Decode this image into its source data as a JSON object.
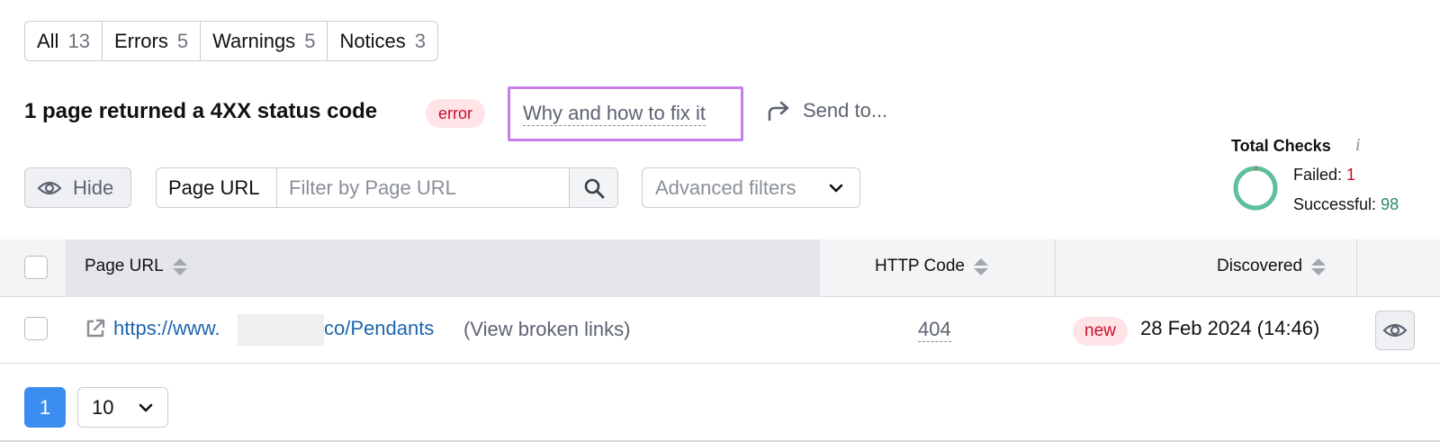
{
  "tabs": [
    {
      "label": "All",
      "count": "13"
    },
    {
      "label": "Errors",
      "count": "5"
    },
    {
      "label": "Warnings",
      "count": "5"
    },
    {
      "label": "Notices",
      "count": "3"
    }
  ],
  "issue": {
    "title": "1 page returned a 4XX status code",
    "severity_badge": "error",
    "fix_link": "Why and how to fix it",
    "send_to": "Send to..."
  },
  "controls": {
    "hide_label": "Hide",
    "filter_label": "Page URL",
    "filter_placeholder": "Filter by Page URL",
    "advanced_filters": "Advanced filters"
  },
  "total_checks": {
    "title": "Total Checks",
    "info_icon": "i",
    "failed_label": "Failed:",
    "failed_value": "1",
    "successful_label": "Successful:",
    "successful_value": "98"
  },
  "table": {
    "columns": {
      "page_url": "Page URL",
      "http_code": "HTTP Code",
      "discovered": "Discovered"
    },
    "rows": [
      {
        "url_start": "https://www.",
        "url_end": "co/Pendants",
        "broken_links": "(View broken links)",
        "http_code": "404",
        "new_badge": "new",
        "discovered": "28 Feb 2024 (14:46)"
      }
    ]
  },
  "pagination": {
    "current_page": "1",
    "per_page": "10"
  },
  "colors": {
    "accent": "#3b8ef0",
    "error_red": "#c8102e",
    "success_green": "#2a8a6b",
    "highlight_purple": "#c77dec",
    "link_blue": "#1e64ad"
  },
  "icons": [
    "eye-icon",
    "search-icon",
    "chevron-down-icon",
    "share-arrow-icon",
    "external-link-icon",
    "info-icon"
  ]
}
